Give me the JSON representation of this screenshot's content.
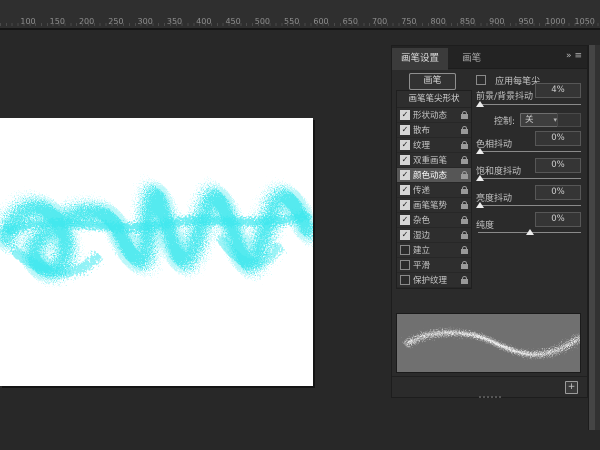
{
  "ruler": {
    "labels": [
      "100",
      "150",
      "200",
      "250",
      "300",
      "350",
      "400",
      "450",
      "500",
      "550",
      "600",
      "650",
      "700",
      "750",
      "800",
      "850",
      "900",
      "950",
      "1000",
      "1050"
    ]
  },
  "panel": {
    "tabs": [
      {
        "label": "画笔设置"
      },
      {
        "label": "画笔"
      }
    ],
    "collapse_icon": "»",
    "menu_icon": "≡",
    "brushes_button": "画笔",
    "tip_shape": "画笔笔尖形状",
    "items": [
      {
        "label": "形状动态",
        "checked": true,
        "selected": false
      },
      {
        "label": "散布",
        "checked": true,
        "selected": false
      },
      {
        "label": "纹理",
        "checked": true,
        "selected": false
      },
      {
        "label": "双重画笔",
        "checked": true,
        "selected": false
      },
      {
        "label": "颜色动态",
        "checked": true,
        "selected": true
      },
      {
        "label": "传递",
        "checked": true,
        "selected": false
      },
      {
        "label": "画笔笔势",
        "checked": true,
        "selected": false
      },
      {
        "label": "杂色",
        "checked": true,
        "selected": false
      },
      {
        "label": "湿边",
        "checked": true,
        "selected": false
      },
      {
        "label": "建立",
        "checked": false,
        "selected": false
      },
      {
        "label": "平滑",
        "checked": false,
        "selected": false
      },
      {
        "label": "保护纹理",
        "checked": false,
        "selected": false
      }
    ],
    "controls": {
      "apply_per_tip": {
        "label": "应用每笔尖",
        "checked": false
      },
      "fg_bg": {
        "label": "前景/背景抖动",
        "value": "4%",
        "pos": 2
      },
      "control": {
        "label": "控制:",
        "value": "关",
        "chevron": "▾"
      },
      "hue": {
        "label": "色相抖动",
        "value": "0%",
        "pos": 2
      },
      "sat": {
        "label": "饱和度抖动",
        "value": "0%",
        "pos": 2
      },
      "bri": {
        "label": "亮度抖动",
        "value": "0%",
        "pos": 2
      },
      "purity": {
        "label": "纯度",
        "value": "0%",
        "pos": 50
      }
    },
    "new_brush_icon": "+"
  },
  "colors": {
    "stroke_cyan": "#3be7ee",
    "preview_stroke": "#f0f0f0",
    "canvas_bg": "#ffffff"
  }
}
